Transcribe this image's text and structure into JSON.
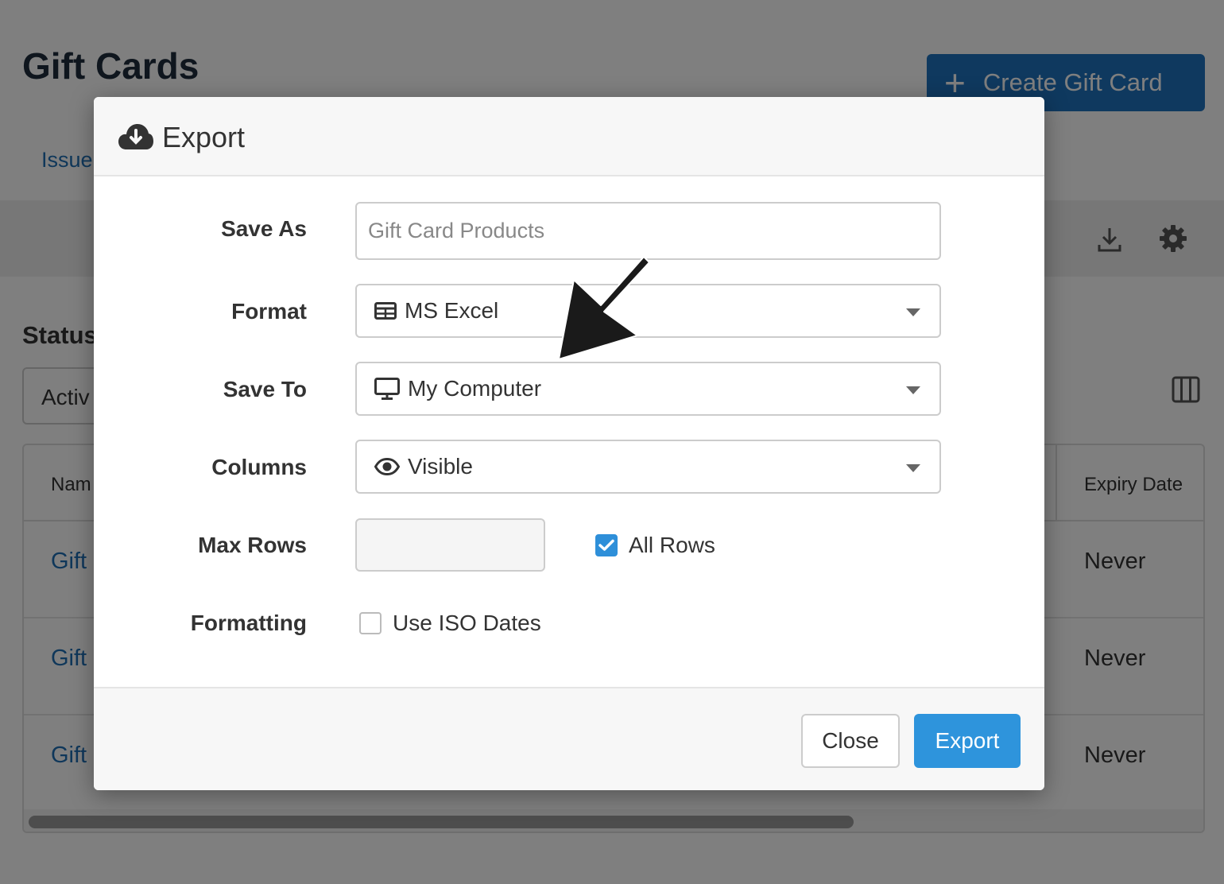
{
  "page": {
    "title": "Gift Cards",
    "create_button_label": "Create Gift Card",
    "tab_issued": "Issue",
    "status_label": "Status",
    "status_value": "Activ",
    "table": {
      "col_name": "Nam",
      "col_expiry": "Expiry Date",
      "rows": [
        {
          "name": "Gift",
          "expiry": "Never"
        },
        {
          "name": "Gift",
          "expiry": "Never"
        },
        {
          "name": "Gift",
          "expiry": "Never"
        }
      ]
    }
  },
  "modal": {
    "title": "Export",
    "save_as": {
      "label": "Save As",
      "placeholder": "Gift Card Products"
    },
    "format": {
      "label": "Format",
      "value": "MS Excel",
      "icon": "table-icon"
    },
    "save_to": {
      "label": "Save To",
      "value": "My Computer",
      "icon": "desktop-icon"
    },
    "columns": {
      "label": "Columns",
      "value": "Visible",
      "icon": "eye-icon"
    },
    "max_rows": {
      "label": "Max Rows",
      "value": "",
      "all_rows_label": "All Rows",
      "all_rows_checked": true
    },
    "formatting": {
      "label": "Formatting",
      "iso_dates_label": "Use ISO Dates",
      "iso_dates_checked": false
    },
    "close_label": "Close",
    "export_label": "Export"
  },
  "colors": {
    "primary": "#1e73be",
    "export_button": "#2e94dc",
    "link": "#1e6fb5"
  }
}
